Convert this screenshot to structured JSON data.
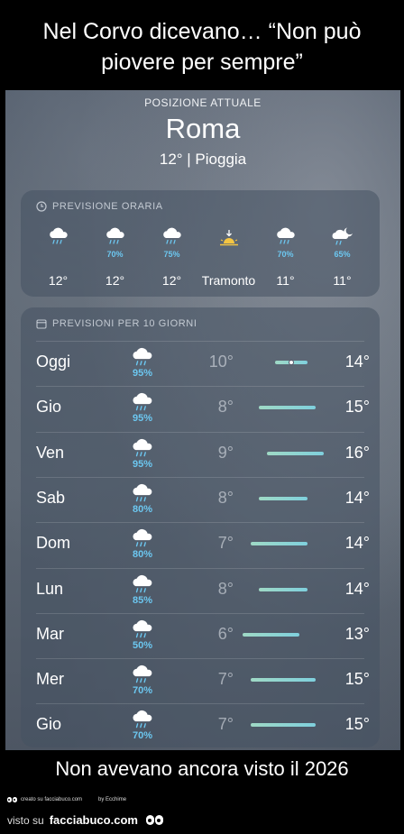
{
  "caption_top": {
    "line1": "Nel Corvo dicevano… “Non può",
    "line2": "piovere per sempre”"
  },
  "header": {
    "location_label": "POSIZIONE ATTUALE",
    "city": "Roma",
    "condition": "12° | Pioggia"
  },
  "hourly": {
    "title": "PREVISIONE ORARIA",
    "title_icon": "clock-icon",
    "items": [
      {
        "icon": "cloud-rain-icon",
        "pct": "",
        "temp": "12°"
      },
      {
        "icon": "cloud-rain-icon",
        "pct": "70%",
        "temp": "12°"
      },
      {
        "icon": "cloud-rain-icon",
        "pct": "75%",
        "temp": "12°"
      },
      {
        "icon": "sunset-icon",
        "pct": "",
        "temp": "Tramonto"
      },
      {
        "icon": "cloud-rain-icon",
        "pct": "70%",
        "temp": "11°"
      },
      {
        "icon": "cloud-moon-rain-icon",
        "pct": "65%",
        "temp": "11°"
      }
    ]
  },
  "daily": {
    "title": "PREVISIONI PER 10 GIORNI",
    "title_icon": "calendar-icon",
    "range_min": 6,
    "range_max": 16,
    "items": [
      {
        "day": "Oggi",
        "pct": "95%",
        "low": "10°",
        "high": "14°",
        "low_val": 10,
        "high_val": 14,
        "current": 12
      },
      {
        "day": "Gio",
        "pct": "95%",
        "low": "8°",
        "high": "15°",
        "low_val": 8,
        "high_val": 15
      },
      {
        "day": "Ven",
        "pct": "95%",
        "low": "9°",
        "high": "16°",
        "low_val": 9,
        "high_val": 16
      },
      {
        "day": "Sab",
        "pct": "80%",
        "low": "8°",
        "high": "14°",
        "low_val": 8,
        "high_val": 14
      },
      {
        "day": "Dom",
        "pct": "80%",
        "low": "7°",
        "high": "14°",
        "low_val": 7,
        "high_val": 14
      },
      {
        "day": "Lun",
        "pct": "85%",
        "low": "8°",
        "high": "14°",
        "low_val": 8,
        "high_val": 14
      },
      {
        "day": "Mar",
        "pct": "50%",
        "low": "6°",
        "high": "13°",
        "low_val": 6,
        "high_val": 13
      },
      {
        "day": "Mer",
        "pct": "70%",
        "low": "7°",
        "high": "15°",
        "low_val": 7,
        "high_val": 15
      },
      {
        "day": "Gio",
        "pct": "70%",
        "low": "7°",
        "high": "15°",
        "low_val": 7,
        "high_val": 15
      }
    ]
  },
  "caption_bottom": "Non avevano ancora visto il 2026",
  "credits": {
    "created": "creato su facciabuco.com",
    "by": "by Ecchime",
    "visto": "visto su",
    "site": "facciabuco.com"
  },
  "colors": {
    "precip": "#6cc7f0",
    "bar_start": "#9fd9c5",
    "bar_end": "#7fd0dd"
  }
}
